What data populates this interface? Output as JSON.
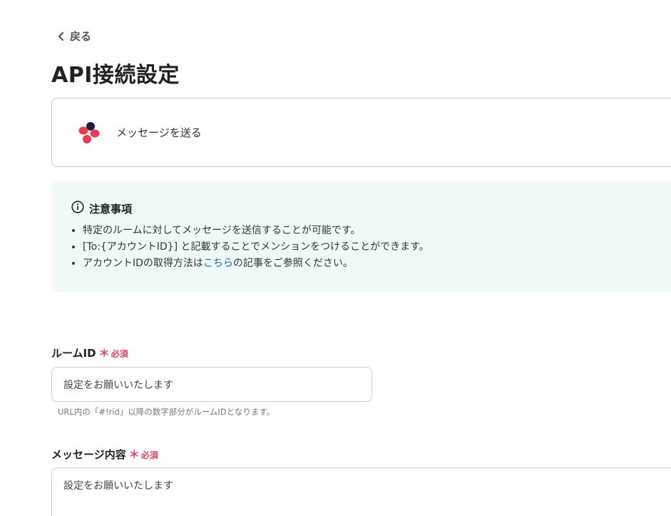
{
  "nav": {
    "back_label": "戻る"
  },
  "page": {
    "title": "API接続設定"
  },
  "action": {
    "label": "メッセージを送る"
  },
  "notice": {
    "heading": "注意事項",
    "items": [
      {
        "text": "特定のルームに対してメッセージを送信することが可能です。"
      },
      {
        "text": "[To:{アカウントID}] と記載することでメンションをつけることができます。"
      },
      {
        "prefix": "アカウントIDの取得方法は",
        "link": "こちら",
        "suffix": "の記事をご参照ください。"
      }
    ]
  },
  "fields": {
    "room_id": {
      "label": "ルームID",
      "required_mark": "＊",
      "required_text": "必須",
      "placeholder": "設定をお願いいたします",
      "hint": "URL内の「#!rid」以降の数字部分がルームIDとなります。"
    },
    "message": {
      "label": "メッセージ内容",
      "required_mark": "＊",
      "required_text": "必須",
      "placeholder": "設定をお願いいたします"
    }
  },
  "colors": {
    "required": "#e1455d",
    "link": "#1b6fa8",
    "notice_bg": "#f1f9f8",
    "logo_red": "#ef3b50",
    "logo_dark": "#1a1f3a"
  },
  "icons": {
    "back": "chevron-left-icon",
    "info": "info-circle-icon",
    "app": "chatwork-logo"
  }
}
